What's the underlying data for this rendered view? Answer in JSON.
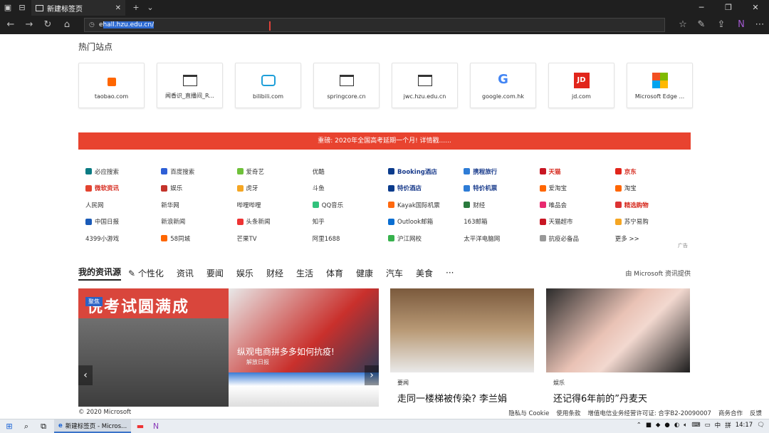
{
  "browser": {
    "tab_title": "新建标签页",
    "address": "ehall.hzu.edu.cn/",
    "address_prefix": "e",
    "address_selected": "hall.hzu.edu.cn/"
  },
  "hot_sites": {
    "title": "热门站点",
    "tiles": [
      {
        "label": "taobao.com",
        "icon": "taobao-icon"
      },
      {
        "label": "闻香识_直播间_R...",
        "icon": "page-icon"
      },
      {
        "label": "bilibili.com",
        "icon": "bilibili-icon"
      },
      {
        "label": "springcore.cn",
        "icon": "page-icon"
      },
      {
        "label": "jwc.hzu.edu.cn",
        "icon": "page-icon"
      },
      {
        "label": "google.com.hk",
        "icon": "google-icon"
      },
      {
        "label": "jd.com",
        "icon": "jd-icon"
      },
      {
        "label": "Microsoft Edge ...",
        "icon": "microsoft-icon"
      }
    ]
  },
  "banner": "重磅: 2020年全国高考延期一个月! 详情戳......",
  "links": [
    [
      "必应搜索",
      "百度搜索",
      "爱奇艺",
      "优酷",
      "Booking酒店",
      "携程旅行",
      "天猫",
      "京东"
    ],
    [
      "微软资讯",
      "娱乐",
      "虎牙",
      "斗鱼",
      "特价酒店",
      "特价机票",
      "爱淘宝",
      "淘宝"
    ],
    [
      "人民网",
      "新华网",
      "哔哩哔哩",
      "QQ音乐",
      "Kayak国际机票",
      "财经",
      "唯品会",
      "精选购物"
    ],
    [
      "中国日报",
      "新浪新闻",
      "头条新闻",
      "知乎",
      "Outlook邮箱",
      "163邮箱",
      "天猫超市",
      "苏宁易购"
    ],
    [
      "4399小游戏",
      "58同城",
      "芒果TV",
      "阿里1688",
      "沪江网校",
      "太平洋电脑网",
      "抗疫必备品",
      "更多 >>"
    ]
  ],
  "ad_label": "广告",
  "news_nav": {
    "items": [
      "我的资讯源",
      "✎ 个性化",
      "资讯",
      "要闻",
      "娱乐",
      "财经",
      "生活",
      "体育",
      "健康",
      "汽车",
      "美食",
      "···"
    ],
    "provider": "由 Microsoft 资讯提供"
  },
  "cards": {
    "feature": {
      "badge": "聚焦",
      "image_text": "悦考试圆满成",
      "caption": "纵观电商拼多多如何抗疫!",
      "source": "解放日报"
    },
    "card2": {
      "tag": "要闻",
      "headline": "走同一楼梯被传染? 李兰娟"
    },
    "card3": {
      "tag": "娱乐",
      "headline": "还记得6年前的”丹麦天"
    }
  },
  "footer": {
    "copyright": "© 2020 Microsoft",
    "links": [
      "隐私与 Cookie",
      "使用条款",
      "增值电信业务经营许可证: 合字B2-20090007",
      "商务合作",
      "反馈"
    ]
  },
  "taskbar": {
    "app_label": "新建标签页 - Micros...",
    "time": "14:17",
    "ime": "中",
    "ime2": "拼"
  }
}
